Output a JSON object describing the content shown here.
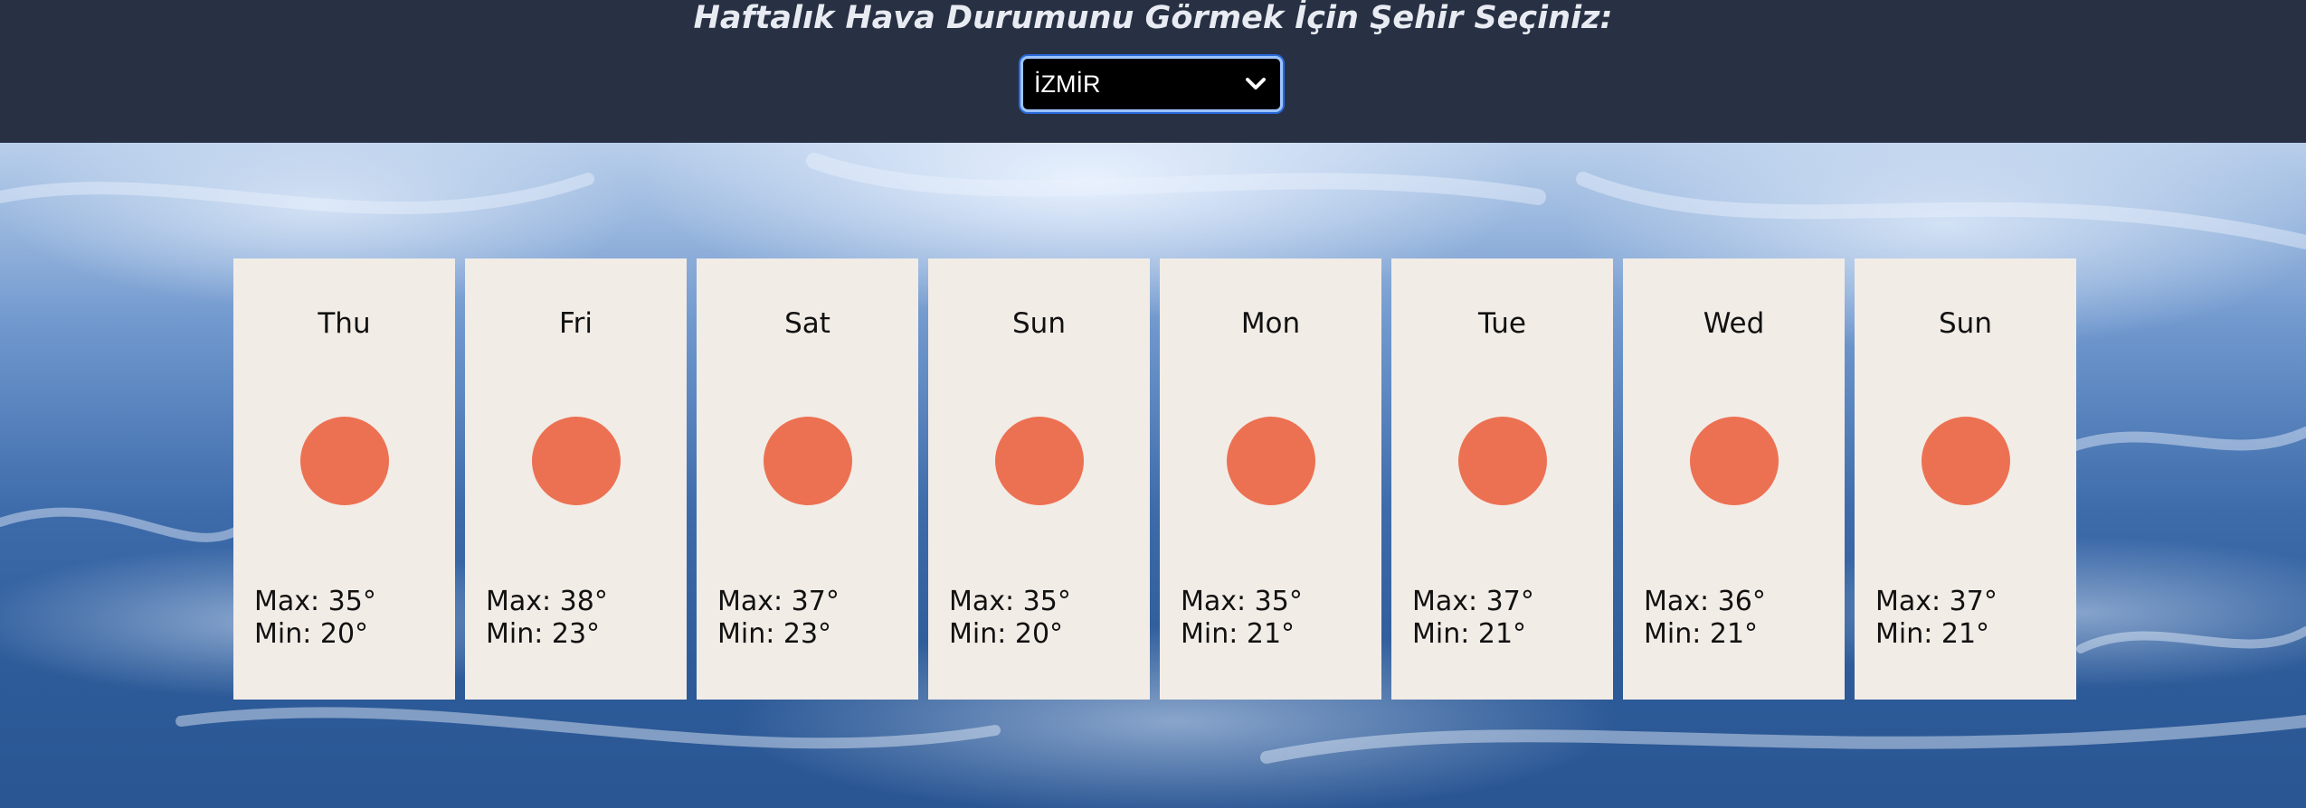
{
  "header": {
    "title": "Haftalık Hava Durumunu Görmek İçin Şehir Seçiniz:",
    "city_select": {
      "value": "İZMİR",
      "icon": "chevron-down-icon"
    }
  },
  "forecast": [
    {
      "day": "Thu",
      "icon": "sun-icon",
      "max": "Max: 35°",
      "min": "Min: 20°"
    },
    {
      "day": "Fri",
      "icon": "sun-icon",
      "max": "Max: 38°",
      "min": "Min: 23°"
    },
    {
      "day": "Sat",
      "icon": "sun-icon",
      "max": "Max: 37°",
      "min": "Min: 23°"
    },
    {
      "day": "Sun",
      "icon": "sun-icon",
      "max": "Max: 35°",
      "min": "Min: 20°"
    },
    {
      "day": "Mon",
      "icon": "sun-icon",
      "max": "Max: 35°",
      "min": "Min: 21°"
    },
    {
      "day": "Tue",
      "icon": "sun-icon",
      "max": "Max: 37°",
      "min": "Min: 21°"
    },
    {
      "day": "Wed",
      "icon": "sun-icon",
      "max": "Max: 36°",
      "min": "Min: 21°"
    },
    {
      "day": "Sun",
      "icon": "sun-icon",
      "max": "Max: 37°",
      "min": "Min: 21°"
    }
  ],
  "colors": {
    "header_bg": "#283044",
    "card_bg": "#f2ece6",
    "sun": "#ec7152"
  }
}
